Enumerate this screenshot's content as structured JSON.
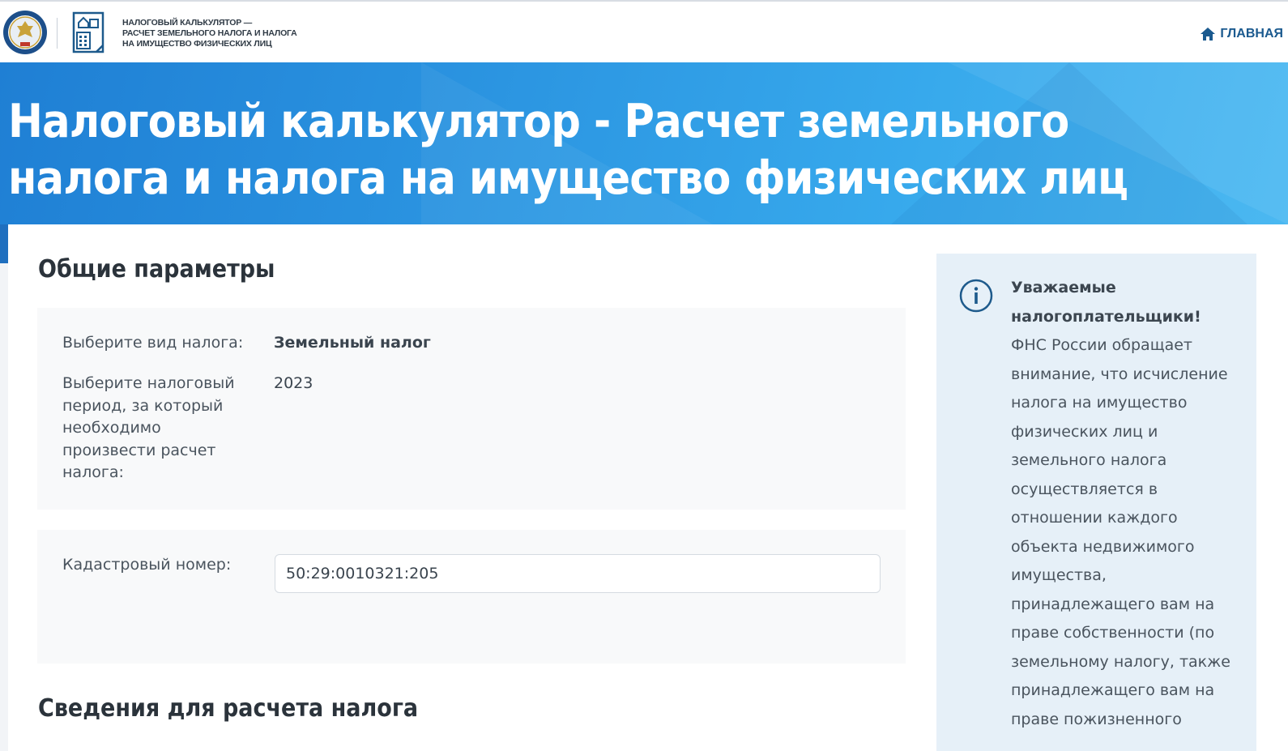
{
  "header": {
    "title_line1": "НАЛОГОВЫЙ КАЛЬКУЛЯТОР —",
    "title_line2": "РАСЧЕТ ЗЕМЕЛЬНОГО НАЛОГА И НАЛОГА",
    "title_line3": "НА ИМУЩЕСТВО ФИЗИЧЕСКИХ ЛИЦ",
    "nav_home_label": "ГЛАВНАЯ",
    "emblem_icon": "fns-emblem-icon",
    "calc_icon": "calculator-document-icon"
  },
  "banner": {
    "title": "Налоговый калькулятор - Расчет земельного налога и налога на имущество физических лиц"
  },
  "general": {
    "section_title": "Общие параметры",
    "tax_type_label": "Выберите вид налога:",
    "tax_type_value": "Земельный налог",
    "period_label": "Выберите налоговый период, за который необходимо произвести расчет налога:",
    "period_value": "2023"
  },
  "cadastral": {
    "label": "Кадастровый номер:",
    "value": "50:29:0010321:205"
  },
  "calc_info": {
    "section_title": "Сведения для расчета налога"
  },
  "notice": {
    "greeting": "Уважаемые налогоплательщики!",
    "body": "ФНС России обращает внимание, что исчисление налога на имущество физических лиц и земельного налога осуществляется в отношении каждого объекта недвижимого имущества, принадлежащего вам на праве собственности (по земельному налогу, также принадлежащего вам на праве пожизненного"
  },
  "colors": {
    "accent": "#1b5a8f",
    "banner": "#2a93e0",
    "info_bg": "#e6f0f8"
  }
}
